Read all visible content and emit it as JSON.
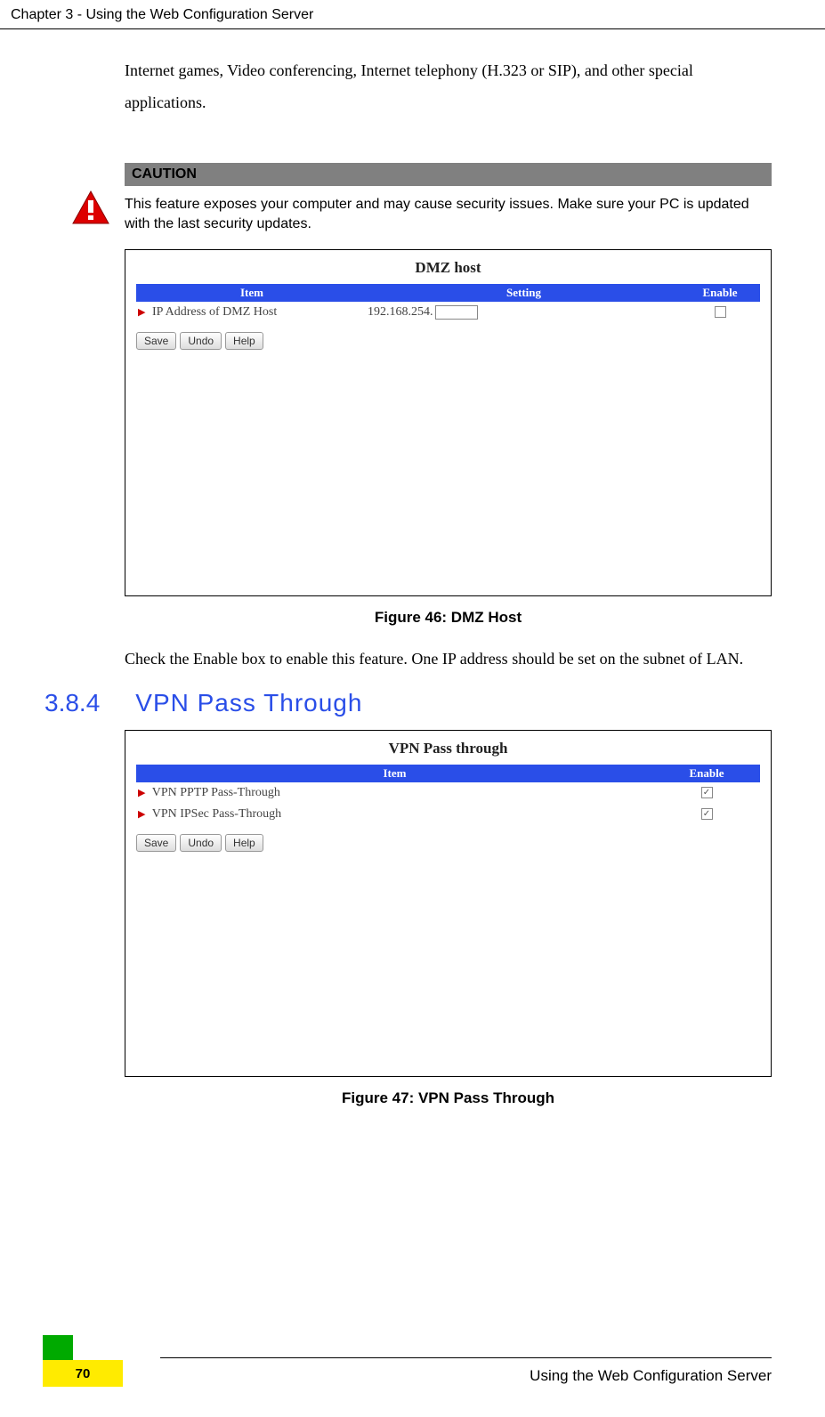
{
  "header": {
    "chapter_title": "Chapter 3 - Using the Web Configuration Server"
  },
  "intro": "Internet games, Video conferencing, Internet telephony (H.323 or SIP), and other special applications.",
  "caution": {
    "label": "CAUTION",
    "text": "This feature exposes your computer and may cause security issues. Make sure your PC is updated with the last security updates."
  },
  "figure46": {
    "panel_title": "DMZ host",
    "columns": {
      "item": "Item",
      "setting": "Setting",
      "enable": "Enable"
    },
    "row": {
      "item_label": "IP Address of DMZ Host",
      "setting_prefix": "192.168.254.",
      "setting_value": ""
    },
    "buttons": {
      "save": "Save",
      "undo": "Undo",
      "help": "Help"
    },
    "caption": "Figure 46: DMZ Host"
  },
  "body_after_fig46": "Check the Enable box to enable this feature. One IP address should be set on the subnet of LAN.",
  "section": {
    "number": "3.8.4",
    "title": "VPN Pass Through"
  },
  "figure47": {
    "panel_title": "VPN Pass through",
    "columns": {
      "item": "Item",
      "enable": "Enable"
    },
    "rows": [
      {
        "item_label": "VPN PPTP Pass-Through",
        "checked": true
      },
      {
        "item_label": "VPN IPSec Pass-Through",
        "checked": true
      }
    ],
    "buttons": {
      "save": "Save",
      "undo": "Undo",
      "help": "Help"
    },
    "caption": "Figure 47: VPN Pass Through"
  },
  "footer": {
    "text": "Using the Web Configuration Server",
    "page_number": "70"
  }
}
